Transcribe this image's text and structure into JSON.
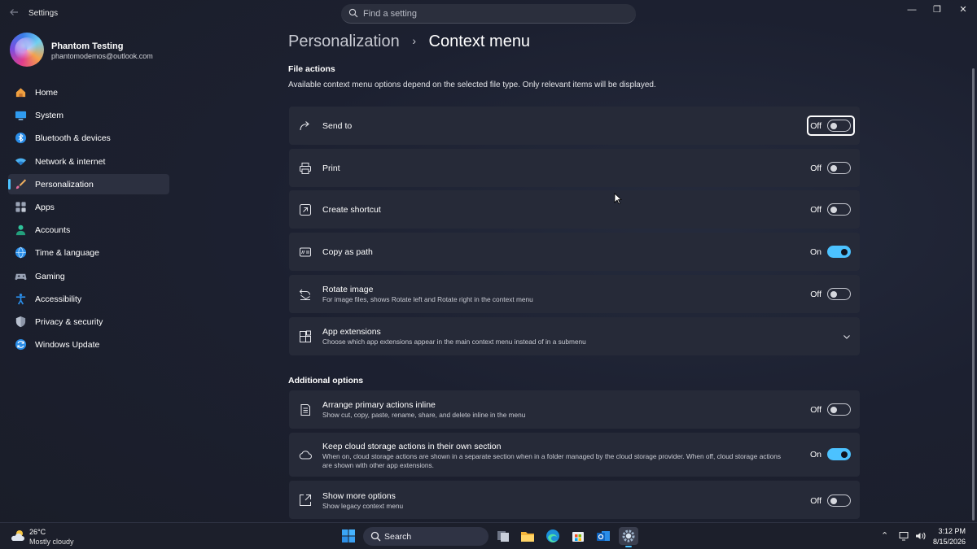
{
  "window": {
    "app_title": "Settings",
    "search_placeholder": "Find a setting",
    "controls": {
      "minimize": "—",
      "restore": "❐",
      "close": "✕"
    }
  },
  "profile": {
    "name": "Phantom Testing",
    "email": "phantomodemos@outlook.com"
  },
  "sidebar": {
    "items": [
      {
        "label": "Home",
        "icon": "home-icon"
      },
      {
        "label": "System",
        "icon": "system-icon"
      },
      {
        "label": "Bluetooth & devices",
        "icon": "bluetooth-icon"
      },
      {
        "label": "Network & internet",
        "icon": "wifi-icon"
      },
      {
        "label": "Personalization",
        "icon": "brush-icon",
        "selected": true
      },
      {
        "label": "Apps",
        "icon": "apps-icon"
      },
      {
        "label": "Accounts",
        "icon": "accounts-icon"
      },
      {
        "label": "Time & language",
        "icon": "globe-icon"
      },
      {
        "label": "Gaming",
        "icon": "gaming-icon"
      },
      {
        "label": "Accessibility",
        "icon": "accessibility-icon"
      },
      {
        "label": "Privacy & security",
        "icon": "shield-icon"
      },
      {
        "label": "Windows Update",
        "icon": "update-icon"
      }
    ]
  },
  "breadcrumb": {
    "parent": "Personalization",
    "separator": "›",
    "current": "Context menu"
  },
  "file_actions": {
    "title": "File actions",
    "description": "Available context menu options depend on the selected file type. Only relevant items will be displayed.",
    "items": [
      {
        "title": "Send to",
        "description": "",
        "state": "Off",
        "on": false,
        "icon": "share-arrow-icon",
        "focused": true
      },
      {
        "title": "Print",
        "description": "",
        "state": "Off",
        "on": false,
        "icon": "printer-icon"
      },
      {
        "title": "Create shortcut",
        "description": "",
        "state": "Off",
        "on": false,
        "icon": "shortcut-icon"
      },
      {
        "title": "Copy as path",
        "description": "",
        "state": "On",
        "on": true,
        "icon": "copy-path-icon"
      },
      {
        "title": "Rotate image",
        "description": "For image files, shows Rotate left and Rotate right in the context menu",
        "state": "Off",
        "on": false,
        "icon": "rotate-icon"
      }
    ],
    "extensions": {
      "title": "App extensions",
      "description": "Choose which app extensions appear in the main context menu instead of in a submenu",
      "icon": "extensions-icon"
    }
  },
  "additional_options": {
    "title": "Additional options",
    "items": [
      {
        "title": "Arrange primary actions inline",
        "description": "Show cut, copy, paste, rename, share, and delete inline in the menu",
        "state": "Off",
        "on": false,
        "icon": "list-icon"
      },
      {
        "title": "Keep cloud storage actions in their own section",
        "description": "When on, cloud storage actions are shown in a separate section when in a folder managed by the cloud storage provider. When off, cloud storage actions are shown with other app extensions.",
        "state": "On",
        "on": true,
        "icon": "cloud-icon"
      },
      {
        "title": "Show more options",
        "description": "Show legacy context menu",
        "state": "Off",
        "on": false,
        "icon": "expand-icon"
      }
    ]
  },
  "taskbar": {
    "weather": {
      "temperature": "26°C",
      "condition": "Mostly cloudy"
    },
    "search_label": "Search",
    "apps": [
      "start-icon",
      "task-view-icon",
      "file-explorer-icon",
      "edge-icon",
      "store-icon",
      "outlook-icon",
      "settings-icon"
    ],
    "tray": {
      "chevron": "⌃",
      "time": "3:12 PM",
      "date": "8/15/2026"
    }
  },
  "colors": {
    "accent": "#4cc2ff",
    "card": "#262a38",
    "background": "#1c2030"
  }
}
